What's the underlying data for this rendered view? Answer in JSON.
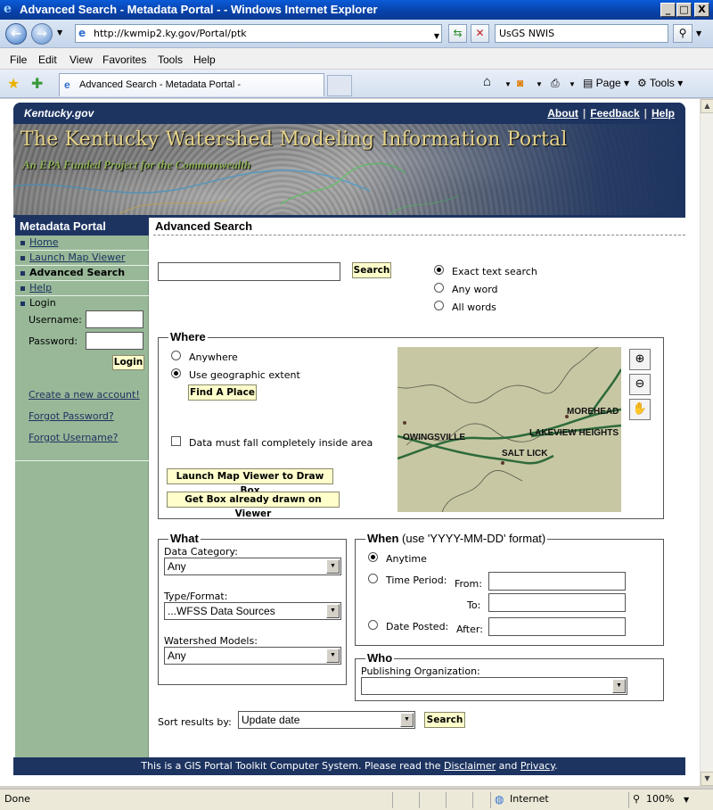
{
  "window": {
    "title": "Advanced Search - Metadata Portal - - Windows Internet Explorer",
    "min": "_",
    "max": "□",
    "close": "X"
  },
  "address_bar": {
    "url": "http://kwmip2.ky.gov/Portal/ptk",
    "search_value": "UsGS NWIS"
  },
  "menu": [
    "File",
    "Edit",
    "View",
    "Favorites",
    "Tools",
    "Help"
  ],
  "tab": {
    "title": "Advanced Search - Metadata Portal -"
  },
  "command_bar": {
    "page_label": "Page",
    "tools_label": "Tools"
  },
  "site": {
    "logo_text": "Kentucky.gov",
    "top_links": [
      "About",
      "Feedback",
      "Help"
    ],
    "banner_title": "The Kentucky Watershed Modeling Information Portal",
    "banner_subtitle": "An EPA Funded Project for the Commonwealth"
  },
  "left_nav": {
    "header": "Metadata Portal",
    "items": [
      {
        "label": "Home"
      },
      {
        "label": "Launch Map Viewer"
      },
      {
        "label": "Advanced Search"
      },
      {
        "label": "Help"
      },
      {
        "label": "Login"
      }
    ],
    "username_label": "Username:",
    "password_label": "Password:",
    "login_button": "Login",
    "create_account": "Create a new account!",
    "forgot_password": "Forgot Password?",
    "forgot_username": "Forgot Username?"
  },
  "main": {
    "title": "Advanced Search",
    "search_button": "Search",
    "search_options": [
      "Exact text search",
      "Any word",
      "All words"
    ],
    "where": {
      "legend": "Where",
      "anywhere": "Anywhere",
      "use_extent": "Use geographic extent",
      "find_place": "Find A Place",
      "inside_area": "Data must fall completely inside area",
      "launch_map": "Launch Map Viewer to Draw Box",
      "get_box": "Get Box already drawn on Viewer",
      "map_places": [
        "MOREHEAD",
        "LAKEVIEW HEIGHTS",
        "OWINGSVILLE",
        "SALT LICK"
      ]
    },
    "what": {
      "legend": "What",
      "data_category_label": "Data Category:",
      "data_category_value": "Any",
      "type_label": "Type/Format:",
      "type_value": "...WFSS Data Sources",
      "models_label": "Watershed Models:",
      "models_value": "Any"
    },
    "when": {
      "legend": "When",
      "legend_note": "(use 'YYYY-MM-DD' format)",
      "anytime": "Anytime",
      "time_period": "Time Period:",
      "from": "From:",
      "to": "To:",
      "date_posted": "Date Posted:",
      "after": "After:"
    },
    "who": {
      "legend": "Who",
      "org_label": "Publishing Organization:"
    },
    "sort_label": "Sort results by:",
    "sort_value": "Update date",
    "sort_search_button": "Search"
  },
  "footer": {
    "prefix": "This is a GIS Portal Toolkit Computer System. Please read the",
    "disclaimer": "Disclaimer",
    "and": "and",
    "privacy": "Privacy",
    "suffix": "."
  },
  "status_bar": {
    "status": "Done",
    "zone": "Internet",
    "zoom": "100%"
  }
}
